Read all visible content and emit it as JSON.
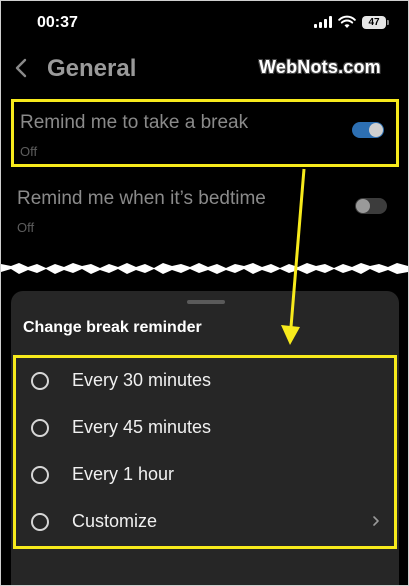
{
  "status_bar": {
    "time": "00:37",
    "battery": "47",
    "icons": [
      "signal-icon",
      "wifi-icon",
      "battery-icon"
    ]
  },
  "nav": {
    "title": "General",
    "back_icon": "chevron-left-icon"
  },
  "watermark": "WebNots.com",
  "settings": [
    {
      "label": "Remind me to take a break",
      "value": "Off",
      "toggle": "on"
    },
    {
      "label": "Remind me when it’s bedtime",
      "value": "Off",
      "toggle": "off"
    }
  ],
  "sheet": {
    "title": "Change break reminder",
    "options": [
      {
        "label": "Every 30 minutes"
      },
      {
        "label": "Every 45 minutes"
      },
      {
        "label": "Every 1 hour"
      },
      {
        "label": "Customize",
        "has_chevron": true
      }
    ]
  },
  "colors": {
    "background": "#000000",
    "sheet": "#262626",
    "highlight": "#f7ea1c",
    "toggle_on": "#2d6fb2",
    "muted_text": "#8a8a8a"
  }
}
